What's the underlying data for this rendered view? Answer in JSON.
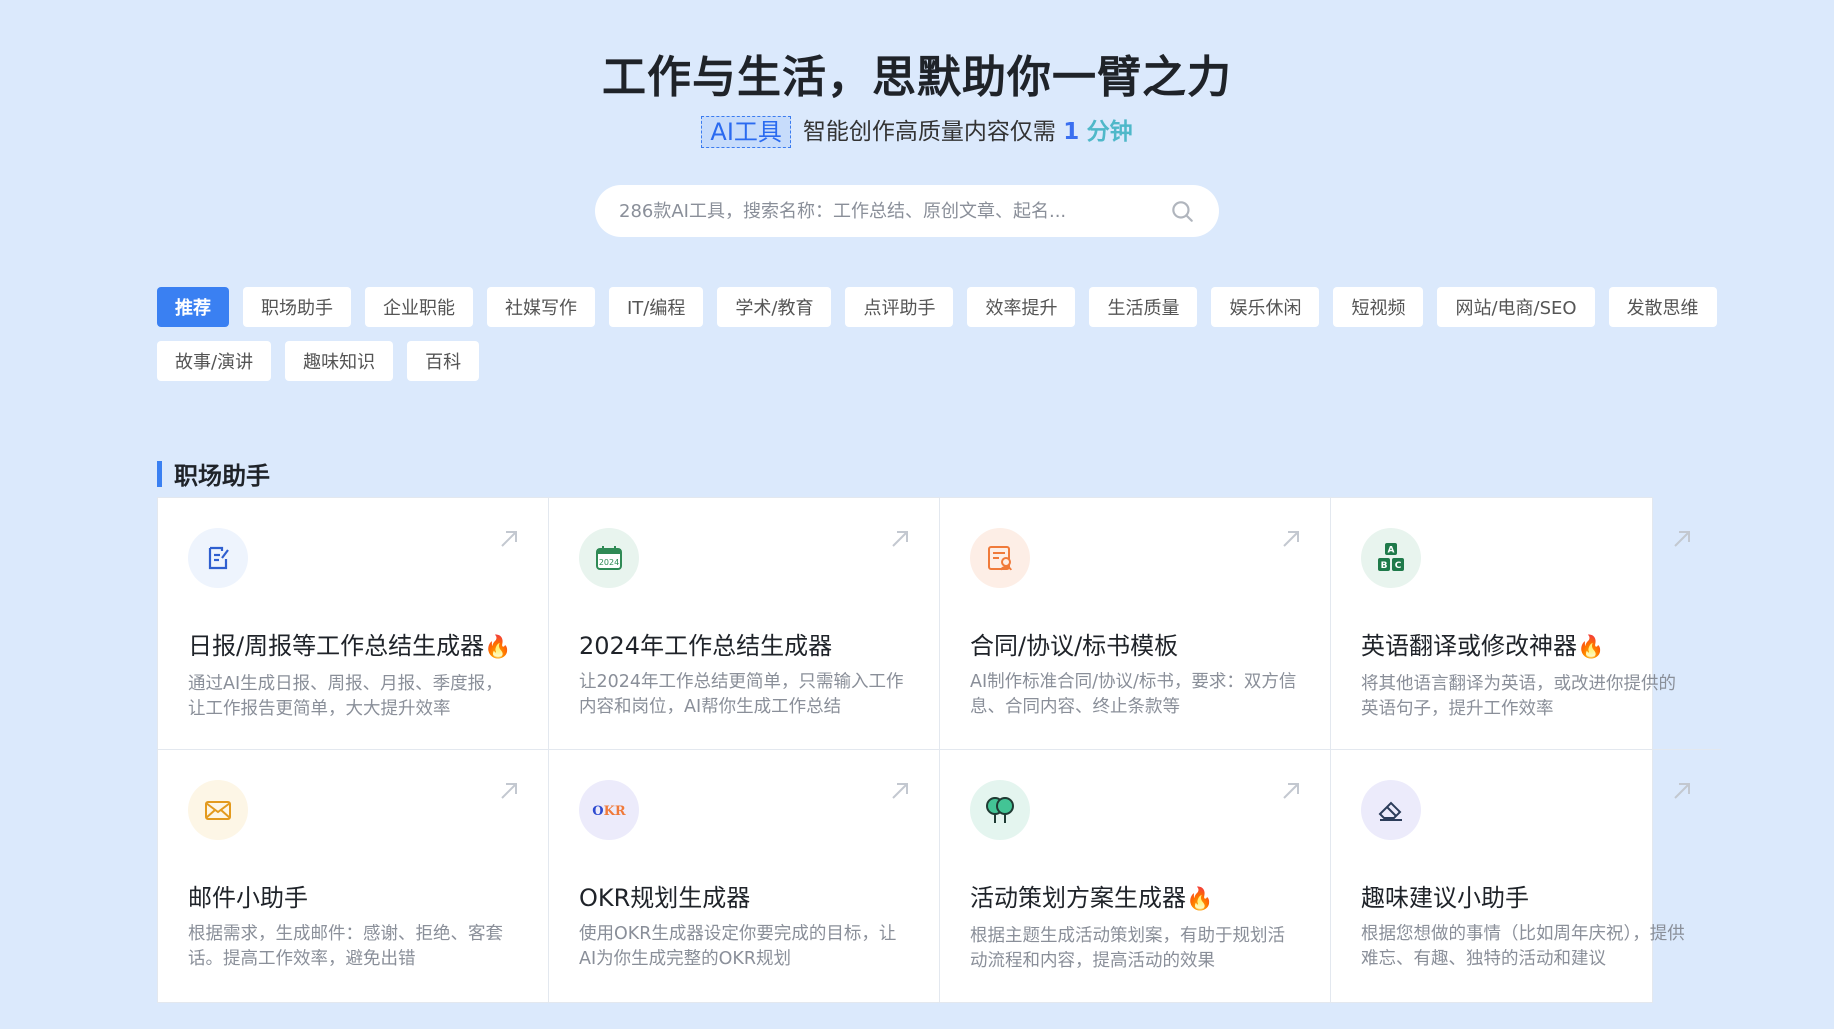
{
  "hero": {
    "title": "工作与生活，思默助你一臂之力",
    "badge": "AI工具",
    "subtitle_text": "智能创作高质量内容仅需",
    "subtitle_num": "1",
    "subtitle_unit": "分钟"
  },
  "search": {
    "placeholder": "286款AI工具，搜索名称：工作总结、原创文章、起名...",
    "icon": "search-icon"
  },
  "tags": [
    {
      "label": "推荐",
      "active": true
    },
    {
      "label": "职场助手"
    },
    {
      "label": "企业职能"
    },
    {
      "label": "社媒写作"
    },
    {
      "label": "IT/编程"
    },
    {
      "label": "学术/教育"
    },
    {
      "label": "点评助手"
    },
    {
      "label": "效率提升"
    },
    {
      "label": "生活质量"
    },
    {
      "label": "娱乐休闲"
    },
    {
      "label": "短视频"
    },
    {
      "label": "网站/电商/SEO"
    },
    {
      "label": "发散思维"
    },
    {
      "label": "故事/演讲"
    },
    {
      "label": "趣味知识"
    },
    {
      "label": "百科"
    }
  ],
  "section": {
    "title": "职场助手"
  },
  "cards": [
    {
      "title": "日报/周报等工作总结生成器",
      "hot": true,
      "desc": "通过AI生成日报、周报、月报、季度报，让工作报告更简单，大大提升效率",
      "icon": "document-edit-icon"
    },
    {
      "title": "2024年工作总结生成器",
      "hot": false,
      "desc": "让2024年工作总结更简单，只需输入工作内容和岗位，AI帮你生成工作总结",
      "icon": "calendar-2024-icon",
      "icon_text": "2024"
    },
    {
      "title": "合同/协议/标书模板",
      "hot": false,
      "desc": "AI制作标准合同/协议/标书，要求：双方信息、合同内容、终止条款等",
      "icon": "contract-icon"
    },
    {
      "title": "英语翻译或修改神器",
      "hot": true,
      "desc": "将其他语言翻译为英语，或改进你提供的英语句子，提升工作效率",
      "icon": "abc-blocks-icon",
      "icon_letters": [
        "A",
        "B",
        "C"
      ]
    },
    {
      "title": "邮件小助手",
      "hot": false,
      "desc": "根据需求，生成邮件：感谢、拒绝、客套话。提高工作效率，避免出错",
      "icon": "mail-icon"
    },
    {
      "title": "OKR规划生成器",
      "hot": false,
      "desc": "使用OKR生成器设定你要完成的目标，让AI为你生成完整的OKR规划",
      "icon": "okr-icon",
      "icon_text": "OKR"
    },
    {
      "title": "活动策划方案生成器",
      "hot": true,
      "desc": "根据主题生成活动策划案，有助于规划活动流程和内容，提高活动的效果",
      "icon": "trees-icon"
    },
    {
      "title": "趣味建议小助手",
      "hot": false,
      "desc": "根据您想做的事情（比如周年庆祝），提供难忘、有趣、独特的活动和建议",
      "icon": "eraser-icon"
    }
  ],
  "colors": {
    "background": "#dbe9fc",
    "accent": "#3a80f2"
  }
}
